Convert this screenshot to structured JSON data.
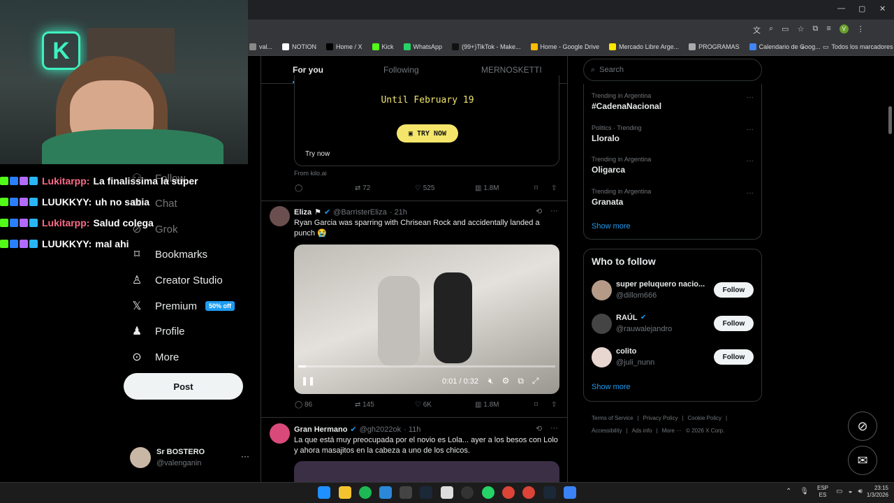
{
  "browser": {
    "bookmarks": [
      {
        "label": "val...",
        "color": "#888"
      },
      {
        "label": "NOTION",
        "color": "#fff"
      },
      {
        "label": "Home / X",
        "color": "#000"
      },
      {
        "label": "Kick",
        "color": "#53fc18"
      },
      {
        "label": "WhatsApp",
        "color": "#25d366"
      },
      {
        "label": "(99+)TikTok - Make...",
        "color": "#111"
      },
      {
        "label": "Home - Google Drive",
        "color": "#fbbc04"
      },
      {
        "label": "Mercado Libre Arge...",
        "color": "#ffe600"
      },
      {
        "label": "PROGRAMAS",
        "color": "#aaa"
      },
      {
        "label": "Calendario de Goog...",
        "color": "#4285f4"
      }
    ],
    "all_bookmarks": "Todos los marcadores"
  },
  "chat": [
    {
      "user": "Lukitarpp:",
      "text": "La finalissima la super",
      "color": "#ff6b8a"
    },
    {
      "user": "LUUKKYY:",
      "text": "uh no sabia",
      "color": "#ffffff"
    },
    {
      "user": "Lukitarpp:",
      "text": "Salud colega",
      "color": "#ff6b8a"
    },
    {
      "user": "LUUKKYY:",
      "text": "mal ahi",
      "color": "#ffffff"
    }
  ],
  "nav": {
    "follow": "Follow",
    "chat": "Chat",
    "grok": "Grok",
    "bookmarks": "Bookmarks",
    "creator": "Creator Studio",
    "premium": "Premium",
    "premium_badge": "50% off",
    "profile": "Profile",
    "more": "More",
    "post": "Post",
    "account_name": "Sr BOSTERO",
    "account_handle": "@valenganin"
  },
  "feed": {
    "tabs": [
      "For you",
      "Following",
      "MERNOSKETTI"
    ],
    "ad": {
      "headline": "Until February 19",
      "cta": "TRY NOW",
      "try_now": "Try now",
      "from": "From kilo.ai",
      "retweets": "72",
      "likes": "525",
      "views": "1.8M"
    },
    "tweet1": {
      "name": "Eliza",
      "handle": "@BarristerEliza",
      "time": "· 21h",
      "text": "Ryan Garcia was sparring with Chrisean Rock and accidentally landed a punch 😭",
      "video_time": "0:01 / 0:32",
      "video_progress": 0.03,
      "replies": "86",
      "retweets": "145",
      "likes": "6K",
      "views": "1.8M"
    },
    "tweet2": {
      "name": "Gran Hermano",
      "handle": "@gh2022ok",
      "time": "· 11h",
      "text": "La que está muy preocupada por el novio es Lola... ayer a los besos con Lolo y ahora masajitos en la cabeza a uno de los chicos."
    }
  },
  "sidebar": {
    "search_placeholder": "Search",
    "trends": [
      {
        "meta": "Trending in Argentina",
        "name": "#CadenaNacional"
      },
      {
        "meta": "Politics · Trending",
        "name": "Lloralo"
      },
      {
        "meta": "Trending in Argentina",
        "name": "Oligarca"
      },
      {
        "meta": "Trending in Argentina",
        "name": "Granata"
      }
    ],
    "show_more": "Show more",
    "who_to_follow": "Who to follow",
    "suggestions": [
      {
        "name": "super peluquero nacio...",
        "handle": "@dillom666"
      },
      {
        "name": "RAÚL",
        "handle": "@rauwalejandro"
      },
      {
        "name": "colito",
        "handle": "@juli_nunn"
      }
    ],
    "follow_label": "Follow",
    "footer": [
      "Terms of Service",
      "|",
      "Privacy Policy",
      "|",
      "Cookie Policy",
      "|",
      "Accessibility",
      "|",
      "Ads info",
      "|",
      "More ···",
      "© 2026 X Corp."
    ]
  },
  "taskbar": {
    "lang": "ESP",
    "region": "ES",
    "time": "23:15",
    "date": "1/3/2026"
  }
}
